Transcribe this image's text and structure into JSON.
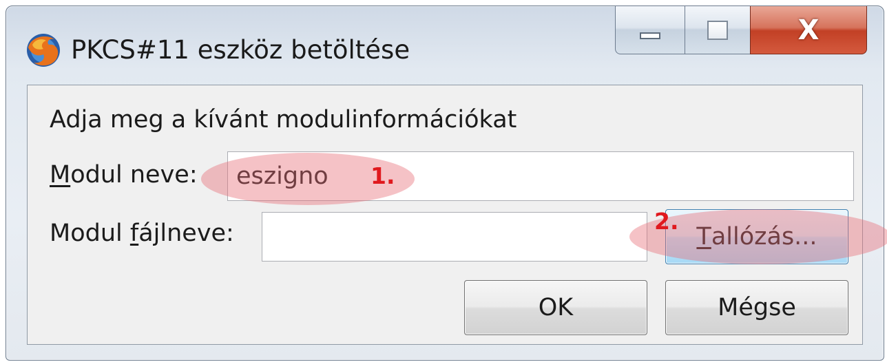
{
  "window": {
    "title": "PKCS#11 eszköz betöltése",
    "icon": "firefox-icon"
  },
  "caption_buttons": {
    "minimize_icon": "minimize-icon",
    "maximize_icon": "maximize-icon",
    "close_glyph": "X"
  },
  "form": {
    "instructions": "Adja meg a kívánt modulinformációkat",
    "module_name": {
      "label_accel": "M",
      "label_rest": "odul neve:",
      "value": "eszigno"
    },
    "module_file": {
      "label_pre": "Modul ",
      "label_accel": "f",
      "label_rest": "ájlneve:",
      "value": ""
    },
    "browse": {
      "accel": "T",
      "rest": "allózás..."
    },
    "ok_label": "OK",
    "cancel_label": "Mégse"
  },
  "annotations": {
    "step1": "1.",
    "step2": "2.",
    "highlight_color": "#e86e76",
    "number_color": "#e0191e"
  }
}
